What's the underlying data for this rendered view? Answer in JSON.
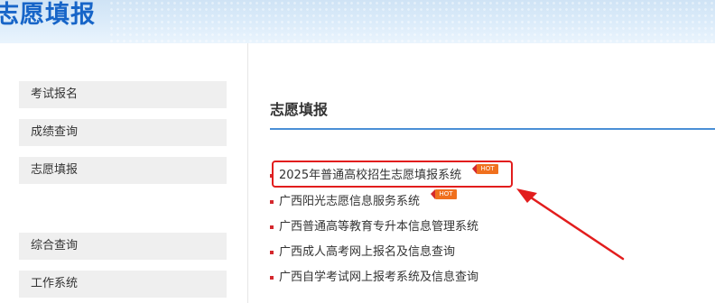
{
  "banner": {
    "title": "志愿填报"
  },
  "sidebar": {
    "items": [
      {
        "label": "考试报名"
      },
      {
        "label": "成绩查询"
      },
      {
        "label": "志愿填报"
      },
      {
        "label": "综合查询"
      },
      {
        "label": "工作系统"
      }
    ]
  },
  "main": {
    "title": "志愿填报",
    "links": [
      {
        "label": "2025年普通高校招生志愿填报系统",
        "badge": "HOT"
      },
      {
        "label": "广西阳光志愿信息服务系统",
        "badge": "HOT"
      },
      {
        "label": "广西普通高等教育专升本信息管理系统"
      },
      {
        "label": "广西成人高考网上报名及信息查询"
      },
      {
        "label": "广西自学考试网上报考系统及信息查询"
      }
    ]
  },
  "colors": {
    "banner_title": "#1765c8",
    "accent_rule": "#4a8fd6",
    "bullet": "#d4282d",
    "hot_badge": "#f0701e",
    "annotation": "#e21d1d"
  }
}
